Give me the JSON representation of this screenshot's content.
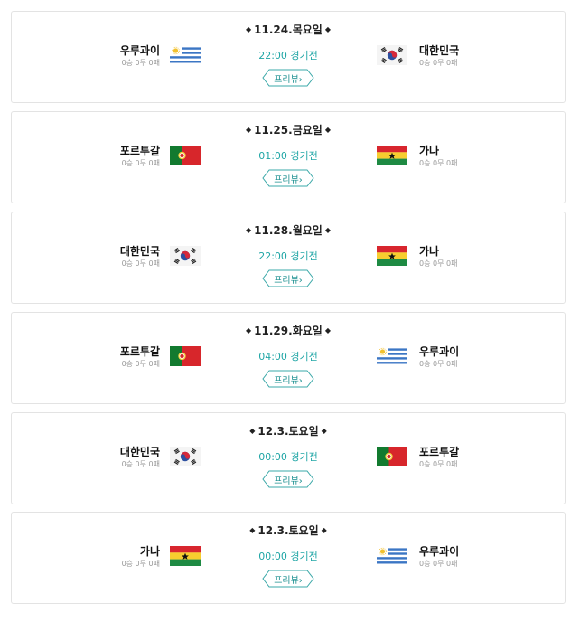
{
  "colors": {
    "accent": "#20a6a6",
    "record": "#999999",
    "border": "#e3e3e3"
  },
  "matches": [
    {
      "date": "11.24.목요일",
      "home": {
        "name": "우루과이",
        "record": "0승 0무 0패",
        "flag": "uruguay-flag-icon"
      },
      "away": {
        "name": "대한민국",
        "record": "0승 0무 0패",
        "flag": "korea-flag-icon"
      },
      "time": "22:00 경기전",
      "preview": "프리뷰"
    },
    {
      "date": "11.25.금요일",
      "home": {
        "name": "포르투갈",
        "record": "0승 0무 0패",
        "flag": "portugal-flag-icon"
      },
      "away": {
        "name": "가나",
        "record": "0승 0무 0패",
        "flag": "ghana-flag-icon"
      },
      "time": "01:00 경기전",
      "preview": "프리뷰"
    },
    {
      "date": "11.28.월요일",
      "home": {
        "name": "대한민국",
        "record": "0승 0무 0패",
        "flag": "korea-flag-icon"
      },
      "away": {
        "name": "가나",
        "record": "0승 0무 0패",
        "flag": "ghana-flag-icon"
      },
      "time": "22:00 경기전",
      "preview": "프리뷰"
    },
    {
      "date": "11.29.화요일",
      "home": {
        "name": "포르투갈",
        "record": "0승 0무 0패",
        "flag": "portugal-flag-icon"
      },
      "away": {
        "name": "우루과이",
        "record": "0승 0무 0패",
        "flag": "uruguay-flag-icon"
      },
      "time": "04:00 경기전",
      "preview": "프리뷰"
    },
    {
      "date": "12.3.토요일",
      "home": {
        "name": "대한민국",
        "record": "0승 0무 0패",
        "flag": "korea-flag-icon"
      },
      "away": {
        "name": "포르투갈",
        "record": "0승 0무 0패",
        "flag": "portugal-flag-icon"
      },
      "time": "00:00 경기전",
      "preview": "프리뷰"
    },
    {
      "date": "12.3.토요일",
      "home": {
        "name": "가나",
        "record": "0승 0무 0패",
        "flag": "ghana-flag-icon"
      },
      "away": {
        "name": "우루과이",
        "record": "0승 0무 0패",
        "flag": "uruguay-flag-icon"
      },
      "time": "00:00 경기전",
      "preview": "프리뷰"
    }
  ]
}
